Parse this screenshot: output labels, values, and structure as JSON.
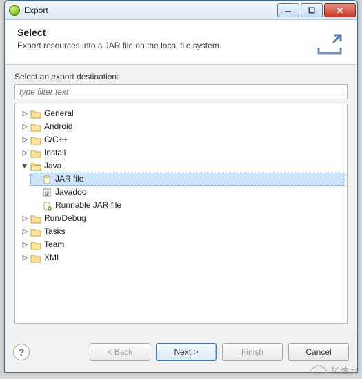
{
  "window": {
    "title": "Export"
  },
  "header": {
    "title": "Select",
    "subtitle": "Export resources into a JAR file on the local file system."
  },
  "body": {
    "label": "Select an export destination:",
    "filter_placeholder": "type filter text"
  },
  "tree": {
    "items": [
      {
        "label": "General",
        "expanded": false
      },
      {
        "label": "Android",
        "expanded": false
      },
      {
        "label": "C/C++",
        "expanded": false
      },
      {
        "label": "Install",
        "expanded": false
      },
      {
        "label": "Java",
        "expanded": true,
        "children": [
          {
            "label": "JAR file",
            "icon": "jar",
            "selected": true
          },
          {
            "label": "Javadoc",
            "icon": "javadoc"
          },
          {
            "label": "Runnable JAR file",
            "icon": "runnable-jar"
          }
        ]
      },
      {
        "label": "Run/Debug",
        "expanded": false
      },
      {
        "label": "Tasks",
        "expanded": false
      },
      {
        "label": "Team",
        "expanded": false
      },
      {
        "label": "XML",
        "expanded": false
      }
    ]
  },
  "buttons": {
    "back": "< Back",
    "next": "Next >",
    "finish": "Finish",
    "cancel": "Cancel"
  },
  "watermark": "亿速云"
}
